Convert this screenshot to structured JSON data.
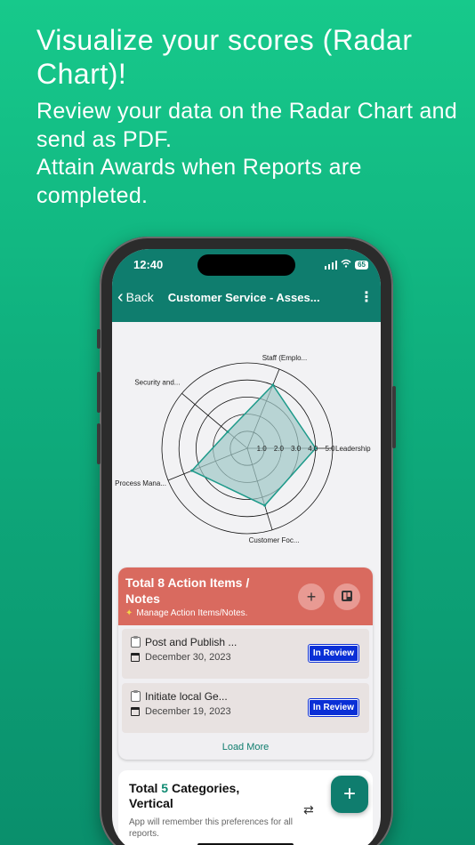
{
  "promo": {
    "title": "Visualize your scores (Radar Chart)!",
    "subtitle_line1": "Review your data on the Radar Chart and send as PDF.",
    "subtitle_line2": "Attain Awards when Reports are completed."
  },
  "status_bar": {
    "time": "12:40",
    "battery": "65"
  },
  "navbar": {
    "back_label": "Back",
    "title": "Customer Service - Asses...",
    "more_icon": "kebab-icon"
  },
  "chart_data": {
    "type": "radar",
    "categories": [
      "Leadership",
      "Staff (Emplo...",
      "Security and...",
      "Process Mana...",
      "Customer Foc..."
    ],
    "ticks": [
      "1.0",
      "2.0",
      "3.0",
      "4.0",
      "5.0"
    ],
    "range": [
      0,
      5
    ],
    "series": [
      {
        "values": [
          4,
          4,
          1.5,
          3.5,
          3.5
        ]
      }
    ],
    "colors": {
      "fill": "#9fc8c6",
      "stroke": "#1e9a8a",
      "grid": "#111111"
    }
  },
  "action_items": {
    "title": "Total 8 Action Items / Notes",
    "subtitle": "Manage Action Items/Notes.",
    "add_icon": "plus-icon",
    "board_icon": "board-icon",
    "items": [
      {
        "title": "Post and Publish ...",
        "date": "December 30, 2023",
        "status": "In Review"
      },
      {
        "title": "Initiate local Ge...",
        "date": "December 19, 2023",
        "status": "In Review"
      }
    ],
    "load_more": "Load More"
  },
  "categories_card": {
    "title_prefix": "Total",
    "count": "5",
    "title_suffix": "Categories, Vertical",
    "note": "App will remember this preferences for all reports."
  },
  "fab": {
    "label": "+"
  }
}
